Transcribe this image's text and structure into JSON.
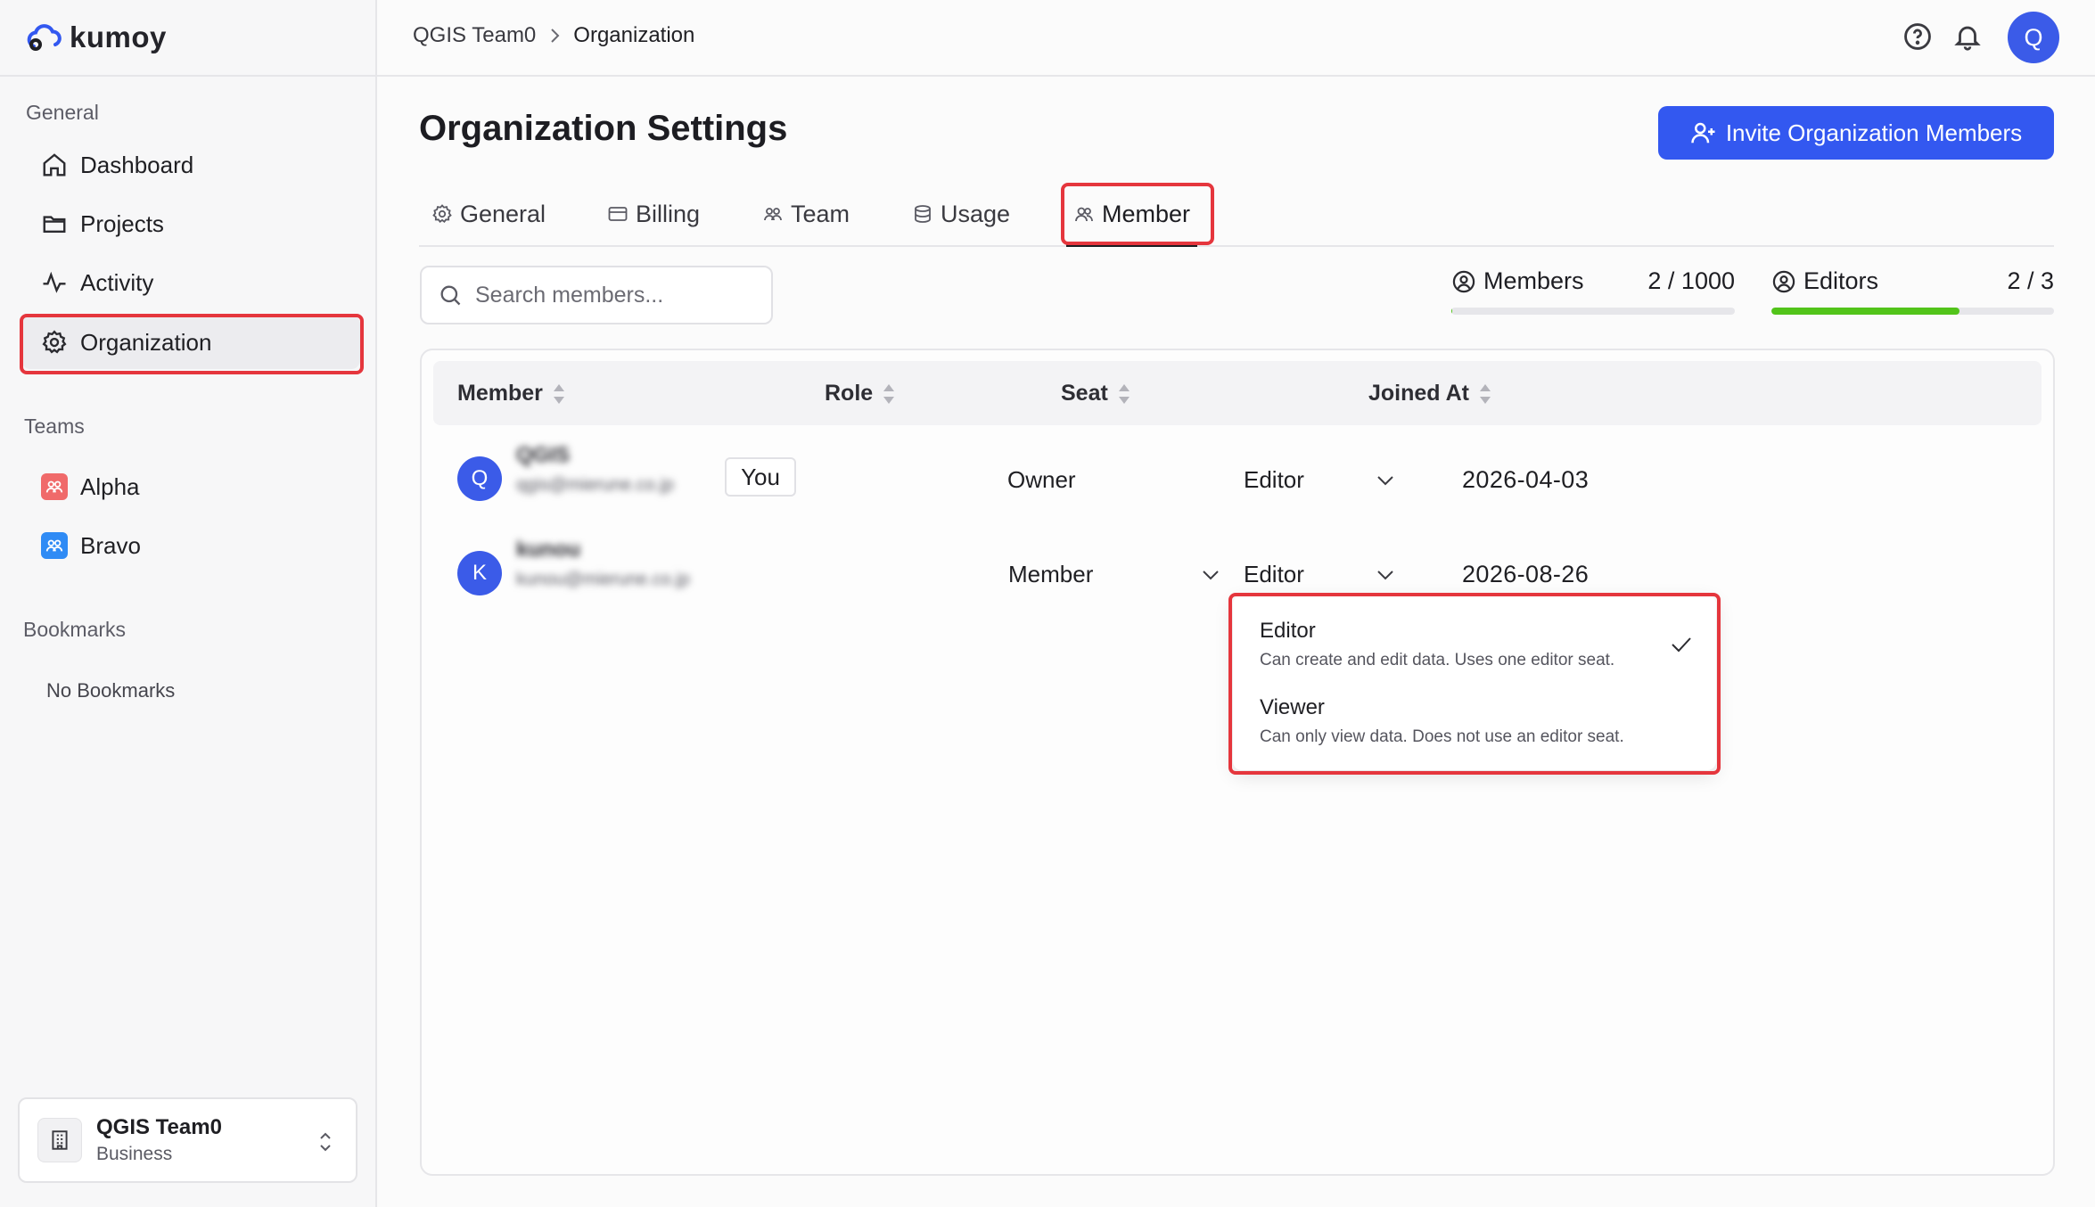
{
  "app": {
    "logo": "kumoy"
  },
  "sidebar": {
    "general_label": "General",
    "items": [
      {
        "label": "Dashboard",
        "icon": "home-icon"
      },
      {
        "label": "Projects",
        "icon": "folder-icon"
      },
      {
        "label": "Activity",
        "icon": "activity-icon"
      },
      {
        "label": "Organization",
        "icon": "gear-icon",
        "active": true
      }
    ],
    "teams_label": "Teams",
    "teams": [
      {
        "label": "Alpha",
        "color": "#f06a6a"
      },
      {
        "label": "Bravo",
        "color": "#2f8bf5"
      }
    ],
    "bookmarks_label": "Bookmarks",
    "no_bookmarks": "No Bookmarks",
    "workspace": {
      "name": "QGIS Team0",
      "plan": "Business"
    }
  },
  "topbar": {
    "breadcrumb": [
      "QGIS Team0",
      "Organization"
    ],
    "avatar": "Q"
  },
  "main": {
    "title": "Organization Settings",
    "invite_button": "Invite Organization Members",
    "tabs": [
      {
        "label": "General",
        "icon": "gear-icon"
      },
      {
        "label": "Billing",
        "icon": "credit-card-icon"
      },
      {
        "label": "Team",
        "icon": "users-icon"
      },
      {
        "label": "Usage",
        "icon": "database-icon"
      },
      {
        "label": "Member",
        "icon": "members-icon",
        "active": true
      }
    ],
    "search": {
      "placeholder": "Search members...",
      "value": ""
    },
    "stats": {
      "members": {
        "label": "Members",
        "value": "2 / 1000",
        "used": 2,
        "total": 1000
      },
      "editors": {
        "label": "Editors",
        "value": "2 / 3",
        "used": 2,
        "total": 3,
        "color": "#52c41a"
      }
    },
    "table": {
      "headers": [
        "Member",
        "Role",
        "Seat",
        "Joined At"
      ],
      "rows": [
        {
          "avatar": "Q",
          "name": "QGIS",
          "email": "qgis@mierune.co.jp",
          "badge": "You",
          "role": "Owner",
          "seat": "Editor",
          "joined": "2026-04-03"
        },
        {
          "avatar": "K",
          "name": "kunou",
          "email": "kunou@mierune.co.jp",
          "role": "Member",
          "seat": "Editor",
          "joined": "2026-08-26"
        }
      ]
    },
    "seat_dropdown": {
      "options": [
        {
          "title": "Editor",
          "description": "Can create and edit data. Uses one editor seat.",
          "selected": true
        },
        {
          "title": "Viewer",
          "description": "Can only view data. Does not use an editor seat.",
          "selected": false
        }
      ]
    }
  },
  "colors": {
    "accent": "#3358f0",
    "highlight": "#e5363d",
    "progress": "#52c41a"
  }
}
